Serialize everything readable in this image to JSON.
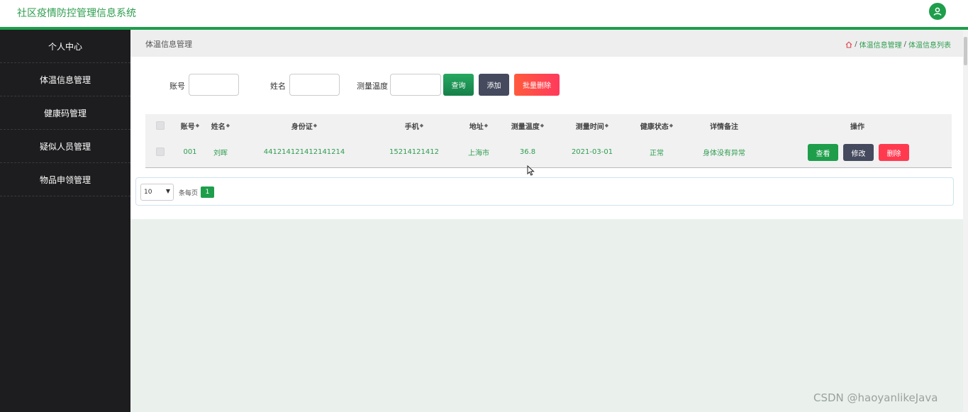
{
  "app": {
    "title": "社区疫情防控管理信息系统",
    "user_icon": "user-icon"
  },
  "colors": {
    "accent": "#1e9e4b",
    "sidebar_bg": "#1d1d1f",
    "danger": "#ff3a4f",
    "dark_button": "#454a5e"
  },
  "sidebar": {
    "items": [
      {
        "label": "个人中心"
      },
      {
        "label": "体温信息管理"
      },
      {
        "label": "健康码管理"
      },
      {
        "label": "疑似人员管理"
      },
      {
        "label": "物品申领管理"
      }
    ]
  },
  "header": {
    "page_title": "体温信息管理",
    "breadcrumb": {
      "sep1": "/",
      "item1": "体温信息管理",
      "sep2": "/",
      "item2": "体温信息列表"
    }
  },
  "search": {
    "account_label": "账号",
    "name_label": "姓名",
    "temp_label": "测量温度",
    "account_value": "",
    "name_value": "",
    "temp_value": "",
    "query_button": "查询",
    "add_button": "添加",
    "batch_delete_button": "批量删除"
  },
  "table": {
    "columns": [
      "账号",
      "姓名",
      "身份证",
      "手机",
      "地址",
      "测量温度",
      "测量时间",
      "健康状态",
      "详情备注",
      "操作"
    ],
    "rows": [
      {
        "account": "001",
        "name": "刘晖",
        "id_card": "441214121412141214",
        "phone": "15214121412",
        "address": "上海市",
        "temperature": "36.8",
        "time": "2021-03-01",
        "health": "正常",
        "remark": "身体没有异常",
        "view_button": "查看",
        "edit_button": "修改",
        "delete_button": "删除"
      }
    ]
  },
  "pagination": {
    "page_size": "10",
    "per_page_label": "条每页",
    "current_page": "1"
  },
  "watermark": "CSDN @haoyanlikeJava"
}
